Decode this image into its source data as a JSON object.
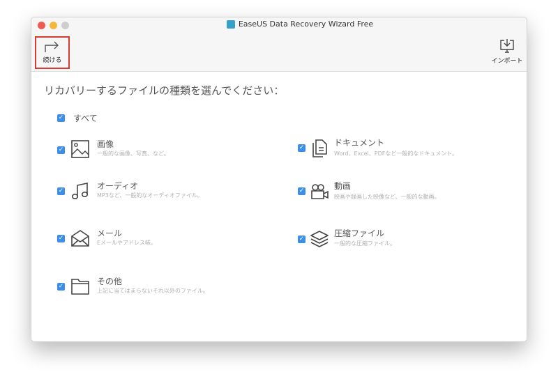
{
  "window": {
    "title": "EaseUS Data Recovery Wizard Free"
  },
  "toolbar": {
    "continue_label": "続ける",
    "import_label": "インポート"
  },
  "heading": "リカバリーするファイルの種類を選んでください：",
  "select_all": {
    "label": "すべて",
    "checked": true
  },
  "items": [
    {
      "label": "画像",
      "desc": "一般的な画像、写真、など。",
      "icon": "image-icon",
      "checked": true
    },
    {
      "label": "オーディオ",
      "desc": "MP3など、一般的なオーディオファイル。",
      "icon": "music-icon",
      "checked": true
    },
    {
      "label": "メール",
      "desc": "Eメールやアドレス帳。",
      "icon": "mail-icon",
      "checked": true
    },
    {
      "label": "その他",
      "desc": "上記に当てはまらないそれ以外のファイル。",
      "icon": "folder-icon",
      "checked": true
    },
    {
      "label": "ドキュメント",
      "desc": "Word、Excel、PDFなど一般的なドキュメント。",
      "icon": "document-icon",
      "checked": true
    },
    {
      "label": "動画",
      "desc": "映画や録画した映像など、一般的な動画。",
      "icon": "video-icon",
      "checked": true
    },
    {
      "label": "圧縮ファイル",
      "desc": "一般的な圧縮ファイル。",
      "icon": "layers-icon",
      "checked": true
    }
  ]
}
